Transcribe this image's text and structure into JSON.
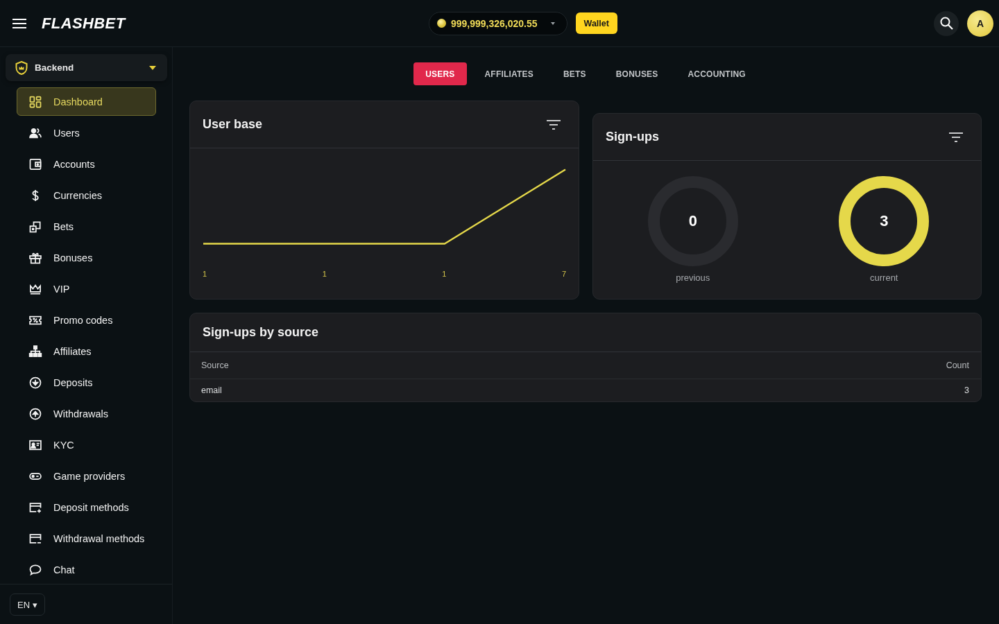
{
  "header": {
    "logo": "FLASHBET",
    "balance": "999,999,326,020.55",
    "wallet_button": "Wallet",
    "avatar": "A"
  },
  "sidebar": {
    "section": "Backend",
    "items": [
      {
        "label": "Dashboard",
        "selected": true
      },
      {
        "label": "Users",
        "selected": false
      },
      {
        "label": "Accounts",
        "selected": false
      },
      {
        "label": "Currencies",
        "selected": false
      },
      {
        "label": "Bets",
        "selected": false
      },
      {
        "label": "Bonuses",
        "selected": false
      },
      {
        "label": "VIP",
        "selected": false
      },
      {
        "label": "Promo codes",
        "selected": false
      },
      {
        "label": "Affiliates",
        "selected": false
      },
      {
        "label": "Deposits",
        "selected": false
      },
      {
        "label": "Withdrawals",
        "selected": false
      },
      {
        "label": "KYC",
        "selected": false
      },
      {
        "label": "Game providers",
        "selected": false
      },
      {
        "label": "Deposit methods",
        "selected": false
      },
      {
        "label": "Withdrawal methods",
        "selected": false
      },
      {
        "label": "Chat",
        "selected": false
      }
    ],
    "language": "EN ▾"
  },
  "tabs": [
    {
      "label": "USERS",
      "selected": true
    },
    {
      "label": "AFFILIATES",
      "selected": false
    },
    {
      "label": "BETS",
      "selected": false
    },
    {
      "label": "BONUSES",
      "selected": false
    },
    {
      "label": "ACCOUNTING",
      "selected": false
    }
  ],
  "user_base": {
    "title": "User base",
    "axis_labels": [
      "1",
      "1",
      "1",
      "7"
    ]
  },
  "signups": {
    "title": "Sign-ups",
    "rings": [
      {
        "value": "0",
        "label": "previous",
        "filled": false
      },
      {
        "value": "3",
        "label": "current",
        "filled": true
      }
    ]
  },
  "signups_by_source": {
    "title": "Sign-ups by source",
    "columns": [
      "Source",
      "Count"
    ],
    "rows": [
      [
        "email",
        "3"
      ]
    ]
  }
}
